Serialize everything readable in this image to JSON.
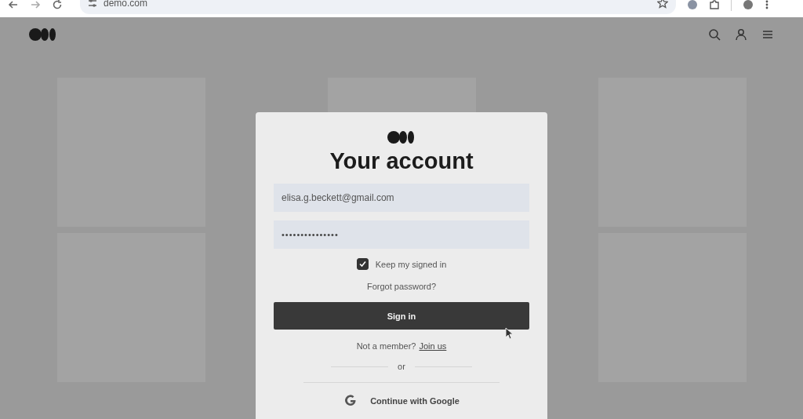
{
  "browser": {
    "address": "demo.com"
  },
  "login": {
    "title": "Your account",
    "email": {
      "value": "elisa.g.beckett@gmail.com"
    },
    "password": {
      "value": "•••••••••••••••"
    },
    "keep_signed_in": {
      "label": "Keep my signed in",
      "checked": true
    },
    "forgot_link": "Forgot password?",
    "sign_in_button": "Sign in",
    "member_prompt": "Not a member?",
    "join_link": "Join us",
    "divider_text": "or",
    "google_button": "Continue with Google"
  }
}
